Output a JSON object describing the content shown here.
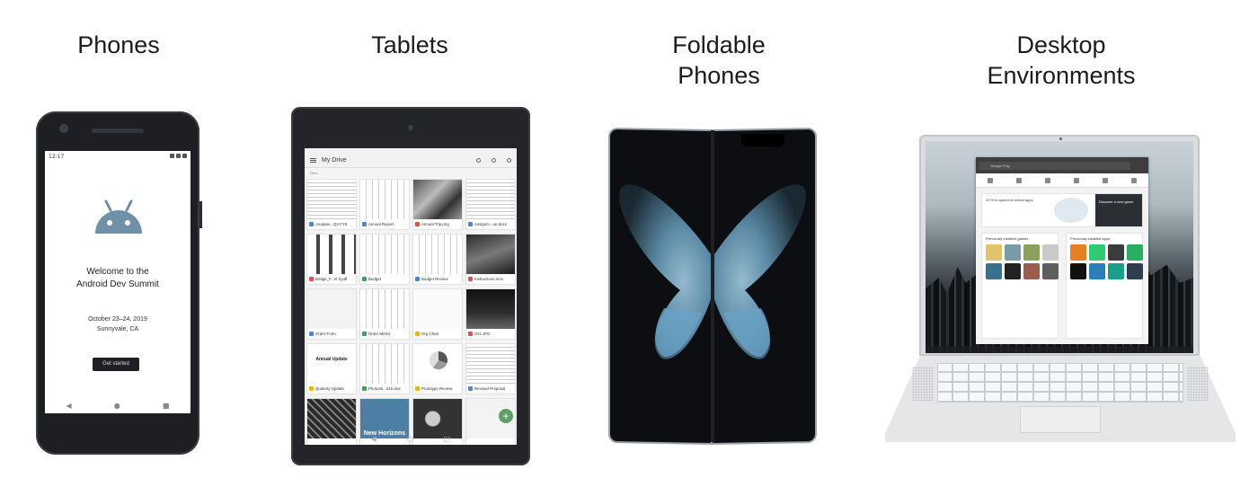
{
  "categories": [
    {
      "label_line1": "Phones",
      "label_line2": ""
    },
    {
      "label_line1": "Tablets",
      "label_line2": ""
    },
    {
      "label_line1": "Foldable",
      "label_line2": "Phones"
    },
    {
      "label_line1": "Desktop",
      "label_line2": "Environments"
    }
  ],
  "phone": {
    "status_time": "12:17",
    "welcome_line1": "Welcome to the",
    "welcome_line2": "Android Dev Summit",
    "date": "October 23–24, 2019",
    "location": "Sunnyvale, CA",
    "button_label": "Get started",
    "nav_back": "◀",
    "nav_home": "●",
    "nav_recent": "■"
  },
  "tablet": {
    "app_title": "My Drive",
    "section_label": "Files",
    "files": [
      {
        "name": "Analysis...Q3 FY8",
        "thumb": "doc",
        "color": "#4a86d8"
      },
      {
        "name": "Annual Report",
        "thumb": "sheet",
        "color": "#4a86d8"
      },
      {
        "name": "Annual Trip.png",
        "thumb": "photo1",
        "color": "#d9534f"
      },
      {
        "name": "Assignm...ue-docs",
        "thumb": "doc",
        "color": "#4a86d8"
      },
      {
        "name": "Bridge_F...el 2.pdf",
        "thumb": "grid",
        "color": "#d9534f"
      },
      {
        "name": "Budget",
        "thumb": "sheet",
        "color": "#34a853"
      },
      {
        "name": "Budget Review",
        "thumb": "sheet",
        "color": "#4a86d8"
      },
      {
        "name": "Instructions.mov",
        "thumb": "photo2",
        "color": "#d9534f"
      },
      {
        "name": "Order Form",
        "thumb": "form",
        "color": "#4a86d8"
      },
      {
        "name": "Order Metrix",
        "thumb": "sheet",
        "color": "#34a853"
      },
      {
        "name": "Org Chart",
        "thumb": "org",
        "color": "#f4b400"
      },
      {
        "name": "Ozz.JPG",
        "thumb": "dark",
        "color": "#d9534f"
      },
      {
        "name": "Quaterly Update",
        "thumb": "annual",
        "color": "#f4b400"
      },
      {
        "name": "Photos5...215.xlsx",
        "thumb": "sheet",
        "color": "#34a853"
      },
      {
        "name": "Prototype Review",
        "thumb": "pie",
        "color": "#f4b400"
      },
      {
        "name": "Revised Proposal",
        "thumb": "doc",
        "color": "#4a86d8"
      },
      {
        "name": "",
        "thumb": "pattern",
        "color": "#777"
      },
      {
        "name": "",
        "thumb": "blue",
        "color": "#777"
      },
      {
        "name": "",
        "thumb": "photo3",
        "color": "#777"
      },
      {
        "name": "",
        "thumb": "form",
        "color": "#777"
      }
    ],
    "annual_title": "Annual Update",
    "new_horizons": "New Horizons",
    "fab_label": "+",
    "nav_back": "◀",
    "nav_home": "○",
    "nav_recent": "□"
  },
  "laptop": {
    "search_placeholder": "Google Play",
    "banner_text": "20 % to spend on select apps",
    "banner_dark_text": "Discover a new game",
    "section1_title": "Previously installed games",
    "section2_title": "Previously installed apps"
  },
  "colors": {
    "droid_green": "#6f90a6",
    "butterfly_blue": "#6aa2c6",
    "fab_green": "#5f9d6b"
  }
}
